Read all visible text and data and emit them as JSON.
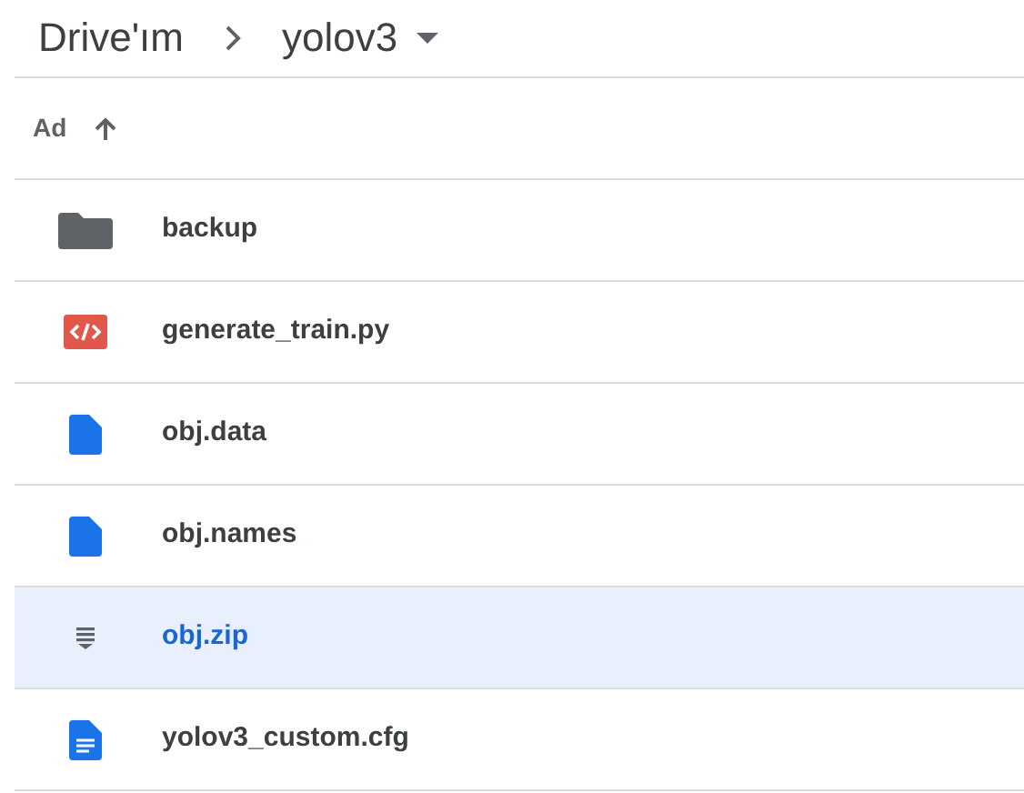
{
  "breadcrumb": [
    {
      "label": "Drive'ım"
    },
    {
      "label": "yolov3"
    }
  ],
  "sort_header": {
    "label": "Ad"
  },
  "files": [
    {
      "name": "backup",
      "kind": "folder",
      "selected": false
    },
    {
      "name": "generate_train.py",
      "kind": "code",
      "selected": false
    },
    {
      "name": "obj.data",
      "kind": "file",
      "selected": false
    },
    {
      "name": "obj.names",
      "kind": "file",
      "selected": false
    },
    {
      "name": "obj.zip",
      "kind": "zip",
      "selected": true
    },
    {
      "name": "yolov3_custom.cfg",
      "kind": "doc",
      "selected": false
    }
  ]
}
